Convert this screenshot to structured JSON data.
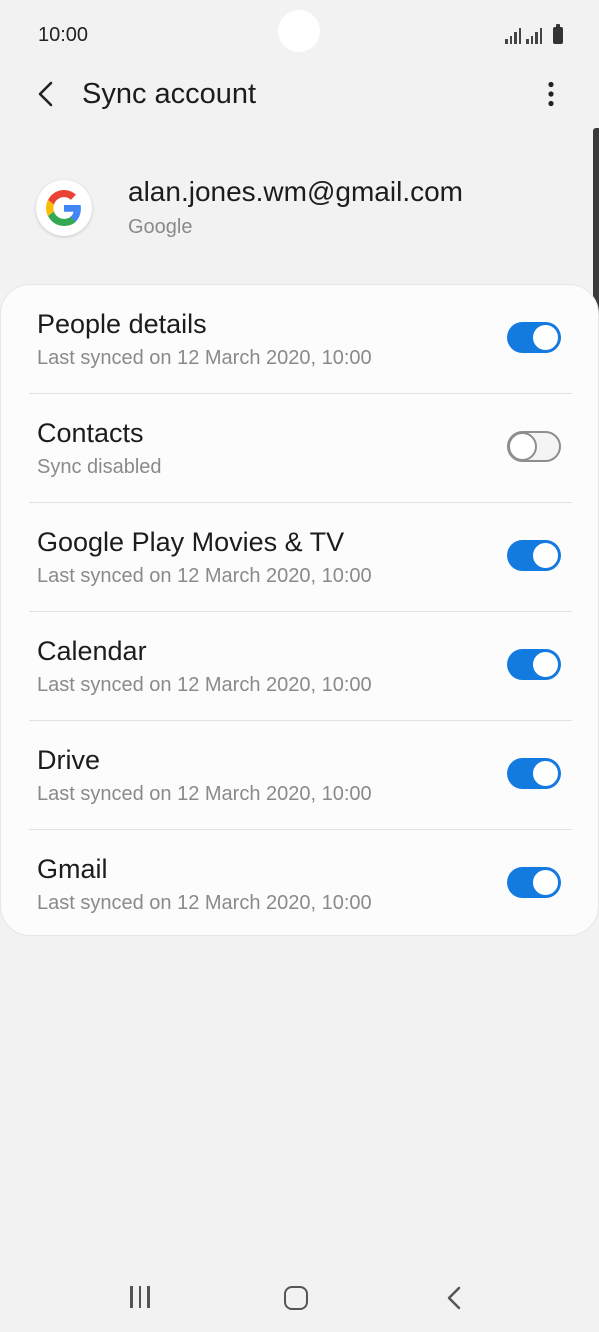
{
  "status_bar": {
    "time": "10:00"
  },
  "header": {
    "title": "Sync account"
  },
  "account": {
    "email": "alan.jones.wm@gmail.com",
    "provider": "Google"
  },
  "sync_items": [
    {
      "title": "People details",
      "subtitle": "Last synced on 12 March 2020, 10:00",
      "enabled": true
    },
    {
      "title": "Contacts",
      "subtitle": "Sync disabled",
      "enabled": false
    },
    {
      "title": "Google Play Movies & TV",
      "subtitle": "Last synced on 12 March 2020, 10:00",
      "enabled": true
    },
    {
      "title": "Calendar",
      "subtitle": "Last synced on 12 March 2020, 10:00",
      "enabled": true
    },
    {
      "title": "Drive",
      "subtitle": "Last synced on 12 March 2020, 10:00",
      "enabled": true
    },
    {
      "title": "Gmail",
      "subtitle": "Last synced on 12 March 2020, 10:00",
      "enabled": true
    }
  ],
  "colors": {
    "accent": "#137ae0",
    "background": "#f2f2f2",
    "card": "#fcfcfc",
    "secondary_text": "#8a8a8a"
  },
  "icons": {
    "back": "chevron-left-icon",
    "more": "more-vertical-icon",
    "logo": "google-logo-icon",
    "nav_recents": "recents-icon",
    "nav_home": "home-icon",
    "nav_back": "back-icon"
  }
}
